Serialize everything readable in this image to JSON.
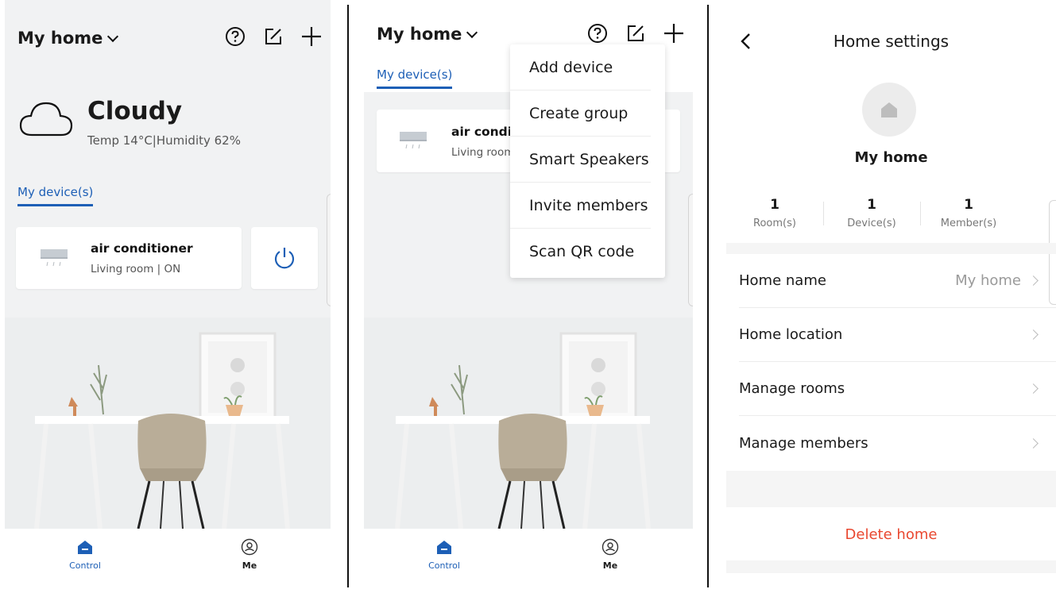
{
  "screen1": {
    "home_title": "My home",
    "weather": {
      "condition": "Cloudy",
      "detail": "Temp 14°C|Humidity 62%"
    },
    "tab": "My device(s)",
    "device": {
      "name": "air conditioner",
      "status": "Living room | ON"
    },
    "nav": {
      "control": "Control",
      "me": "Me"
    }
  },
  "screen2": {
    "home_title": "My home",
    "tab": "My device(s)",
    "device": {
      "name": "air conditi",
      "status": "Living room"
    },
    "menu": [
      "Add device",
      "Create group",
      "Smart Speakers",
      "Invite members",
      "Scan QR code"
    ],
    "nav": {
      "control": "Control",
      "me": "Me"
    }
  },
  "screen3": {
    "title": "Home settings",
    "home_name": "My home",
    "stats": [
      {
        "value": "1",
        "label": "Room(s)"
      },
      {
        "value": "1",
        "label": "Device(s)"
      },
      {
        "value": "1",
        "label": "Member(s)"
      }
    ],
    "rows": [
      {
        "label": "Home name",
        "value": "My home"
      },
      {
        "label": "Home location",
        "value": ""
      },
      {
        "label": "Manage rooms",
        "value": ""
      },
      {
        "label": "Manage members",
        "value": ""
      }
    ],
    "delete_label": "Delete home"
  },
  "colors": {
    "accent": "#1d5fb6",
    "danger": "#e9472f"
  }
}
